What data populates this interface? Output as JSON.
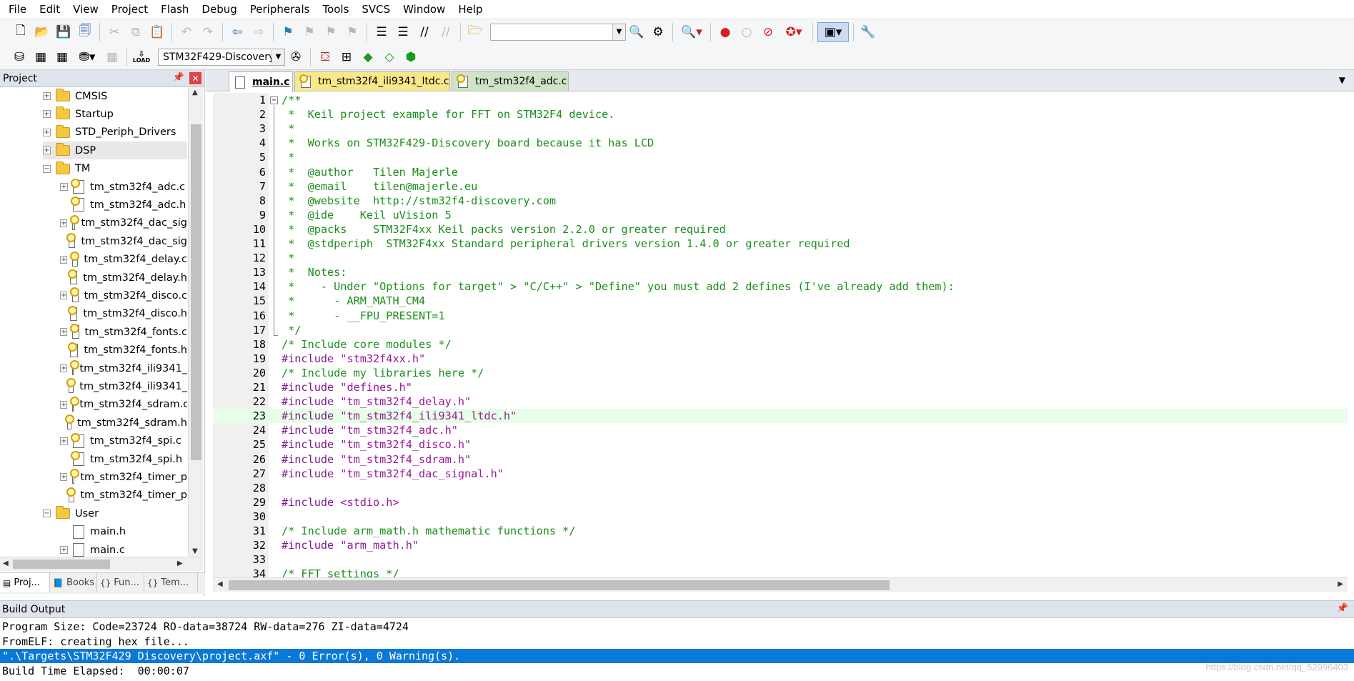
{
  "menu": [
    "File",
    "Edit",
    "View",
    "Project",
    "Flash",
    "Debug",
    "Peripherals",
    "Tools",
    "SVCS",
    "Window",
    "Help"
  ],
  "toolbar": {
    "target_select": "STM32F429-Discovery",
    "load_label": "LOAD"
  },
  "project_pane": {
    "title": "Project",
    "tree": [
      {
        "label": "CMSIS",
        "type": "folder",
        "expander": "+",
        "indent": 1
      },
      {
        "label": "Startup",
        "type": "folder",
        "expander": "+",
        "indent": 1
      },
      {
        "label": "STD_Periph_Drivers",
        "type": "folder",
        "expander": "+",
        "indent": 1
      },
      {
        "label": "DSP",
        "type": "folder",
        "expander": "+",
        "indent": 1
      },
      {
        "label": "TM",
        "type": "folder-open",
        "expander": "−",
        "indent": 1
      },
      {
        "label": "tm_stm32f4_adc.c",
        "type": "file-key",
        "expander": "+",
        "indent": 2
      },
      {
        "label": "tm_stm32f4_adc.h",
        "type": "file-key",
        "expander": "",
        "indent": 2
      },
      {
        "label": "tm_stm32f4_dac_sig",
        "type": "file-key",
        "expander": "+",
        "indent": 2
      },
      {
        "label": "tm_stm32f4_dac_sig",
        "type": "file-key",
        "expander": "",
        "indent": 2
      },
      {
        "label": "tm_stm32f4_delay.c",
        "type": "file-key",
        "expander": "+",
        "indent": 2
      },
      {
        "label": "tm_stm32f4_delay.h",
        "type": "file-key",
        "expander": "",
        "indent": 2
      },
      {
        "label": "tm_stm32f4_disco.c",
        "type": "file-key",
        "expander": "+",
        "indent": 2
      },
      {
        "label": "tm_stm32f4_disco.h",
        "type": "file-key",
        "expander": "",
        "indent": 2
      },
      {
        "label": "tm_stm32f4_fonts.c",
        "type": "file-key",
        "expander": "+",
        "indent": 2
      },
      {
        "label": "tm_stm32f4_fonts.h",
        "type": "file-key",
        "expander": "",
        "indent": 2
      },
      {
        "label": "tm_stm32f4_ili9341_",
        "type": "file-key",
        "expander": "+",
        "indent": 2
      },
      {
        "label": "tm_stm32f4_ili9341_",
        "type": "file-key",
        "expander": "",
        "indent": 2
      },
      {
        "label": "tm_stm32f4_sdram.c",
        "type": "file-key",
        "expander": "+",
        "indent": 2
      },
      {
        "label": "tm_stm32f4_sdram.h",
        "type": "file-key",
        "expander": "",
        "indent": 2
      },
      {
        "label": "tm_stm32f4_spi.c",
        "type": "file-key",
        "expander": "+",
        "indent": 2
      },
      {
        "label": "tm_stm32f4_spi.h",
        "type": "file-key",
        "expander": "",
        "indent": 2
      },
      {
        "label": "tm_stm32f4_timer_p",
        "type": "file-key",
        "expander": "+",
        "indent": 2
      },
      {
        "label": "tm_stm32f4_timer_p",
        "type": "file-key",
        "expander": "",
        "indent": 2
      },
      {
        "label": "User",
        "type": "folder-open",
        "expander": "−",
        "indent": 1
      },
      {
        "label": "main.h",
        "type": "file",
        "expander": "",
        "indent": 2
      },
      {
        "label": "main.c",
        "type": "file",
        "expander": "+",
        "indent": 2
      }
    ],
    "tabs": [
      "Proj...",
      "Books",
      "Fun...",
      "Tem..."
    ]
  },
  "editor": {
    "tabs": [
      {
        "label": "main.c",
        "active": true,
        "color": "#ffffff"
      },
      {
        "label": "tm_stm32f4_ili9341_ltdc.c",
        "active": false,
        "color": "#f7e88a"
      },
      {
        "label": "tm_stm32f4_adc.c",
        "active": false,
        "color": "#cfe3c6"
      }
    ],
    "current_line": 23,
    "lines": [
      [
        [
          "c",
          "/**"
        ]
      ],
      [
        [
          "c",
          " *  Keil project example for FFT on STM32F4 device."
        ]
      ],
      [
        [
          "c",
          " *"
        ]
      ],
      [
        [
          "c",
          " *  Works on STM32F429-Discovery board because it has LCD"
        ]
      ],
      [
        [
          "c",
          " *"
        ]
      ],
      [
        [
          "c",
          " *  @author   Tilen Majerle"
        ]
      ],
      [
        [
          "c",
          " *  @email    tilen@majerle.eu"
        ]
      ],
      [
        [
          "c",
          " *  @website  http://stm32f4-discovery.com"
        ]
      ],
      [
        [
          "c",
          " *  @ide    Keil uVision 5"
        ]
      ],
      [
        [
          "c",
          " *  @packs    STM32F4xx Keil packs version 2.2.0 or greater required"
        ]
      ],
      [
        [
          "c",
          " *  @stdperiph  STM32F4xx Standard peripheral drivers version 1.4.0 or greater required"
        ]
      ],
      [
        [
          "c",
          " *"
        ]
      ],
      [
        [
          "c",
          " *  Notes:"
        ]
      ],
      [
        [
          "c",
          " *    - Under \"Options for target\" > \"C/C++\" > \"Define\" you must add 2 defines (I've already add them):"
        ]
      ],
      [
        [
          "c",
          " *      - ARM_MATH_CM4"
        ]
      ],
      [
        [
          "c",
          " *      - __FPU_PRESENT=1"
        ]
      ],
      [
        [
          "c",
          " */"
        ]
      ],
      [
        [
          "c",
          "/* Include core modules */"
        ]
      ],
      [
        [
          "p",
          "#include "
        ],
        [
          "s",
          "\"stm32f4xx.h\""
        ]
      ],
      [
        [
          "c",
          "/* Include my libraries here */"
        ]
      ],
      [
        [
          "p",
          "#include "
        ],
        [
          "s",
          "\"defines.h\""
        ]
      ],
      [
        [
          "p",
          "#include "
        ],
        [
          "s",
          "\"tm_stm32f4_delay.h\""
        ]
      ],
      [
        [
          "p",
          "#include "
        ],
        [
          "s",
          "\"tm_stm32f4_ili9341_ltdc.h\""
        ]
      ],
      [
        [
          "p",
          "#include "
        ],
        [
          "s",
          "\"tm_stm32f4_adc.h\""
        ]
      ],
      [
        [
          "p",
          "#include "
        ],
        [
          "s",
          "\"tm_stm32f4_disco.h\""
        ]
      ],
      [
        [
          "p",
          "#include "
        ],
        [
          "s",
          "\"tm_stm32f4_sdram.h\""
        ]
      ],
      [
        [
          "p",
          "#include "
        ],
        [
          "s",
          "\"tm_stm32f4_dac_signal.h\""
        ]
      ],
      [],
      [
        [
          "p",
          "#include "
        ],
        [
          "s",
          "<stdio.h>"
        ]
      ],
      [],
      [
        [
          "c",
          "/* Include arm_math.h mathematic functions */"
        ]
      ],
      [
        [
          "p",
          "#include "
        ],
        [
          "s",
          "\"arm_math.h\""
        ]
      ],
      [],
      [
        [
          "c",
          "/* FFT settings */"
        ]
      ]
    ]
  },
  "build_output": {
    "title": "Build Output",
    "lines": [
      {
        "text": "Program Size: Code=23724 RO-data=38724 RW-data=276 ZI-data=4724",
        "selected": false
      },
      {
        "text": "FromELF: creating hex file...",
        "selected": false
      },
      {
        "text": "\".\\Targets\\STM32F429 Discovery\\project.axf\" - 0 Error(s), 0 Warning(s).",
        "selected": true
      },
      {
        "text": "Build Time Elapsed:  00:00:07",
        "selected": false
      }
    ],
    "watermark": "https://blog.csdn.net/qq_52996403"
  },
  "colors": {
    "comment": "#1a8f1a",
    "preprocessor": "#7d1a8f",
    "string": "#9a1a9a",
    "current_line_bg": "#e6ffe6",
    "selection_bg": "#0a78d7"
  }
}
